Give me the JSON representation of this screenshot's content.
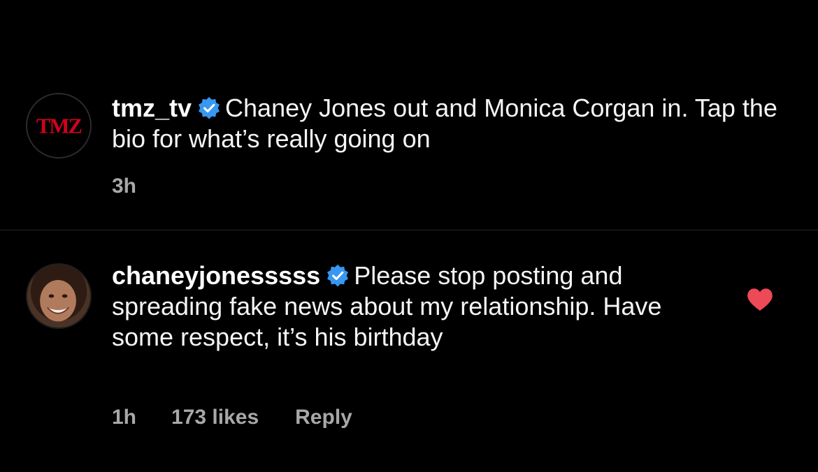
{
  "caption": {
    "username": "tmz_tv",
    "verified": true,
    "text": "Chaney Jones out and Monica Corgan in. Tap the bio for what’s really going on",
    "time": "3h",
    "avatar_logo_text": "TMZ"
  },
  "reply": {
    "username": "chaneyjonesssss",
    "verified": true,
    "text": "Please stop posting and spreading fake news about my relationship. Have some respect, it’s his birthday",
    "time": "1h",
    "likes": "173 likes",
    "reply_label": "Reply",
    "liked": true
  },
  "colors": {
    "background": "#000000",
    "verified_badge": "#3897f0",
    "heart": "#ed4956",
    "meta_text": "#a8a8a8",
    "tmz_red": "#d0021b"
  }
}
